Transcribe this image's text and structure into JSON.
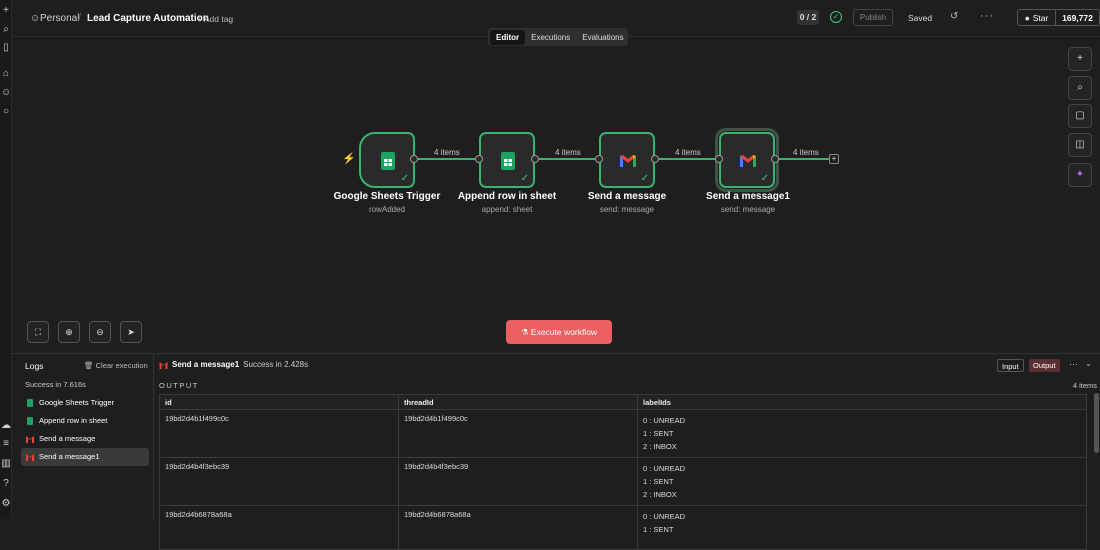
{
  "topbar": {
    "project": "Personal",
    "title": "Lead Capture Automation",
    "add_tag": "+ Add tag",
    "progress": "0 / 2",
    "publish": "Publish",
    "saved": "Saved",
    "github_star": "Star",
    "github_count": "169,772"
  },
  "tabs": [
    "Editor",
    "Executions",
    "Evaluations"
  ],
  "nodes": [
    {
      "name": "Google Sheets Trigger",
      "sub": "rowAdded"
    },
    {
      "name": "Append row in sheet",
      "sub": "append: sheet"
    },
    {
      "name": "Send a message",
      "sub": "send: message"
    },
    {
      "name": "Send a message1",
      "sub": "send: message"
    }
  ],
  "connections": [
    "4 items",
    "4 items",
    "4 items",
    "4 items"
  ],
  "execute_label": "Execute workflow",
  "logs": {
    "title": "Logs",
    "clear": "Clear execution",
    "summary": "Success in 7.616s",
    "items": [
      "Google Sheets Trigger",
      "Append row in sheet",
      "Send a message",
      "Send a message1"
    ]
  },
  "output": {
    "node": "Send a message1",
    "status": "Success in 2.428s",
    "input_btn": "Input",
    "output_btn": "Output",
    "section": "OUTPUT",
    "item_count": "4 items",
    "columns": [
      "id",
      "threadId",
      "labelIds"
    ],
    "rows": [
      {
        "id": "19bd2d4b1f499c0c",
        "threadId": "19bd2d4b1f499c0c",
        "labels": [
          "0 : UNREAD",
          "1 : SENT",
          "2 : INBOX"
        ]
      },
      {
        "id": "19bd2d4b4f3ebc39",
        "threadId": "19bd2d4b4f3ebc39",
        "labels": [
          "0 : UNREAD",
          "1 : SENT",
          "2 : INBOX"
        ]
      },
      {
        "id": "19bd2d4b6878a68a",
        "threadId": "19bd2d4b6878a68a",
        "labels": [
          "0 : UNREAD",
          "1 : SENT"
        ]
      }
    ]
  },
  "colors": {
    "accent_green": "#3cb270",
    "execute_red": "#ea5f5f"
  }
}
